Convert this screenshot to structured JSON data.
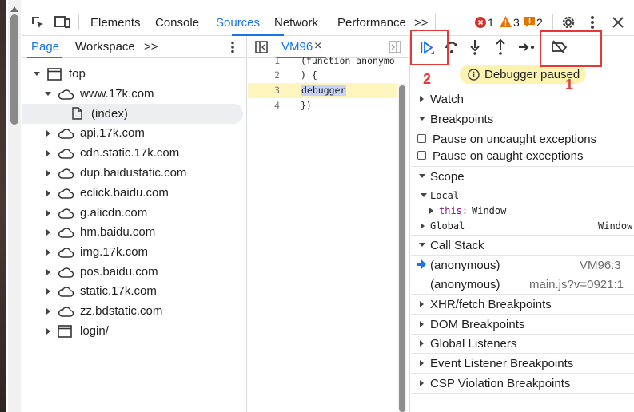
{
  "toolbar": {
    "tabs": [
      "Elements",
      "Console",
      "Sources",
      "Network",
      "Performance"
    ],
    "more": ">>",
    "errors": "1",
    "warnings": "3",
    "issues": "2"
  },
  "navigator": {
    "tabs": [
      "Page",
      "Workspace"
    ],
    "more": ">>",
    "tree": [
      {
        "label": "top"
      },
      {
        "label": "www.17k.com"
      },
      {
        "label": "(index)"
      },
      {
        "label": "api.17k.com"
      },
      {
        "label": "cdn.static.17k.com"
      },
      {
        "label": "dup.baidustatic.com"
      },
      {
        "label": "eclick.baidu.com"
      },
      {
        "label": "g.alicdn.com"
      },
      {
        "label": "hm.baidu.com"
      },
      {
        "label": "img.17k.com"
      },
      {
        "label": "pos.baidu.com"
      },
      {
        "label": "static.17k.com"
      },
      {
        "label": "zz.bdstatic.com"
      },
      {
        "label": "login/"
      }
    ]
  },
  "editor": {
    "file_tab": "VM96",
    "close": "×",
    "lines": [
      {
        "num": "1",
        "code": "(function anonymo"
      },
      {
        "num": "2",
        "code": ") {"
      },
      {
        "num": "3",
        "code": "debugger"
      },
      {
        "num": "4",
        "code": "})"
      }
    ]
  },
  "debugger": {
    "paused_banner": "Debugger paused",
    "sections": {
      "watch": "Watch",
      "breakpoints": "Breakpoints",
      "pause_uncaught": "Pause on uncaught exceptions",
      "pause_caught": "Pause on caught exceptions",
      "scope": "Scope",
      "local": "Local",
      "this_key": "this:",
      "this_val": "Window",
      "global": "Global",
      "global_val": "Window",
      "call_stack": "Call Stack",
      "xhr": "XHR/fetch Breakpoints",
      "dom": "DOM Breakpoints",
      "global_listeners": "Global Listeners",
      "event_listeners": "Event Listener Breakpoints",
      "csp": "CSP Violation Breakpoints"
    },
    "call_stack": [
      {
        "name": "(anonymous)",
        "location": "VM96:3"
      },
      {
        "name": "(anonymous)",
        "location": "main.js?v=0921:1"
      }
    ]
  },
  "annotations": {
    "mark_1": "1",
    "mark_2": "2",
    "color": "#e53935"
  },
  "colors": {
    "accent": "#1a73e8",
    "paused_bg": "#fdf3b0",
    "debug_line_bg": "#fff6bf",
    "error": "#d93025",
    "warning": "#e8710a",
    "issue": "#e37400"
  }
}
